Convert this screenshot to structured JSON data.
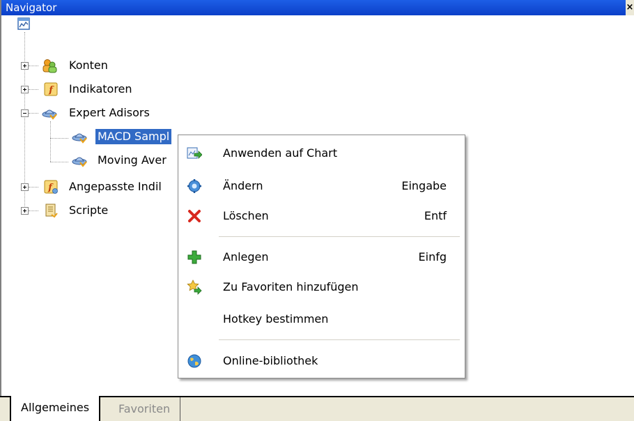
{
  "window": {
    "title": "Navigator",
    "close_label": "×"
  },
  "tree": {
    "root_icon": "terminal-chart-icon",
    "items": [
      {
        "label": "Konten",
        "icon": "accounts-icon",
        "expander": "plus"
      },
      {
        "label": "Indikatoren",
        "icon": "indicator-f-icon",
        "expander": "plus"
      },
      {
        "label": "Expert Adisors",
        "icon": "expert-hat-icon",
        "expander": "minus",
        "children": [
          {
            "label": "MACD Sampl",
            "icon": "expert-hat-icon",
            "selected": true
          },
          {
            "label": "Moving Aver",
            "icon": "expert-hat-icon"
          }
        ]
      },
      {
        "label": "Angepasste Indil",
        "icon": "custom-indicator-icon",
        "expander": "plus"
      },
      {
        "label": "Scripte",
        "icon": "script-scroll-icon",
        "expander": "plus"
      }
    ]
  },
  "context_menu": {
    "items": [
      {
        "label": "Anwenden auf Chart",
        "key": "",
        "icon": "apply-chart-icon"
      },
      {
        "label": "Ändern",
        "key": "Eingabe",
        "icon": "modify-gear-icon"
      },
      {
        "label": "Löschen",
        "key": "Entf",
        "icon": "delete-x-icon"
      },
      {
        "label": "Anlegen",
        "key": "Einfg",
        "icon": "create-plus-icon"
      },
      {
        "label": "Zu Favoriten hinzufügen",
        "key": "",
        "icon": "favorite-star-icon"
      },
      {
        "label": "Hotkey bestimmen",
        "key": "",
        "icon": ""
      },
      {
        "label": "Online-bibliothek",
        "key": "",
        "icon": "online-globe-icon"
      }
    ]
  },
  "tabs": [
    {
      "label": "Allgemeines",
      "active": true
    },
    {
      "label": "Favoriten",
      "active": false
    }
  ]
}
